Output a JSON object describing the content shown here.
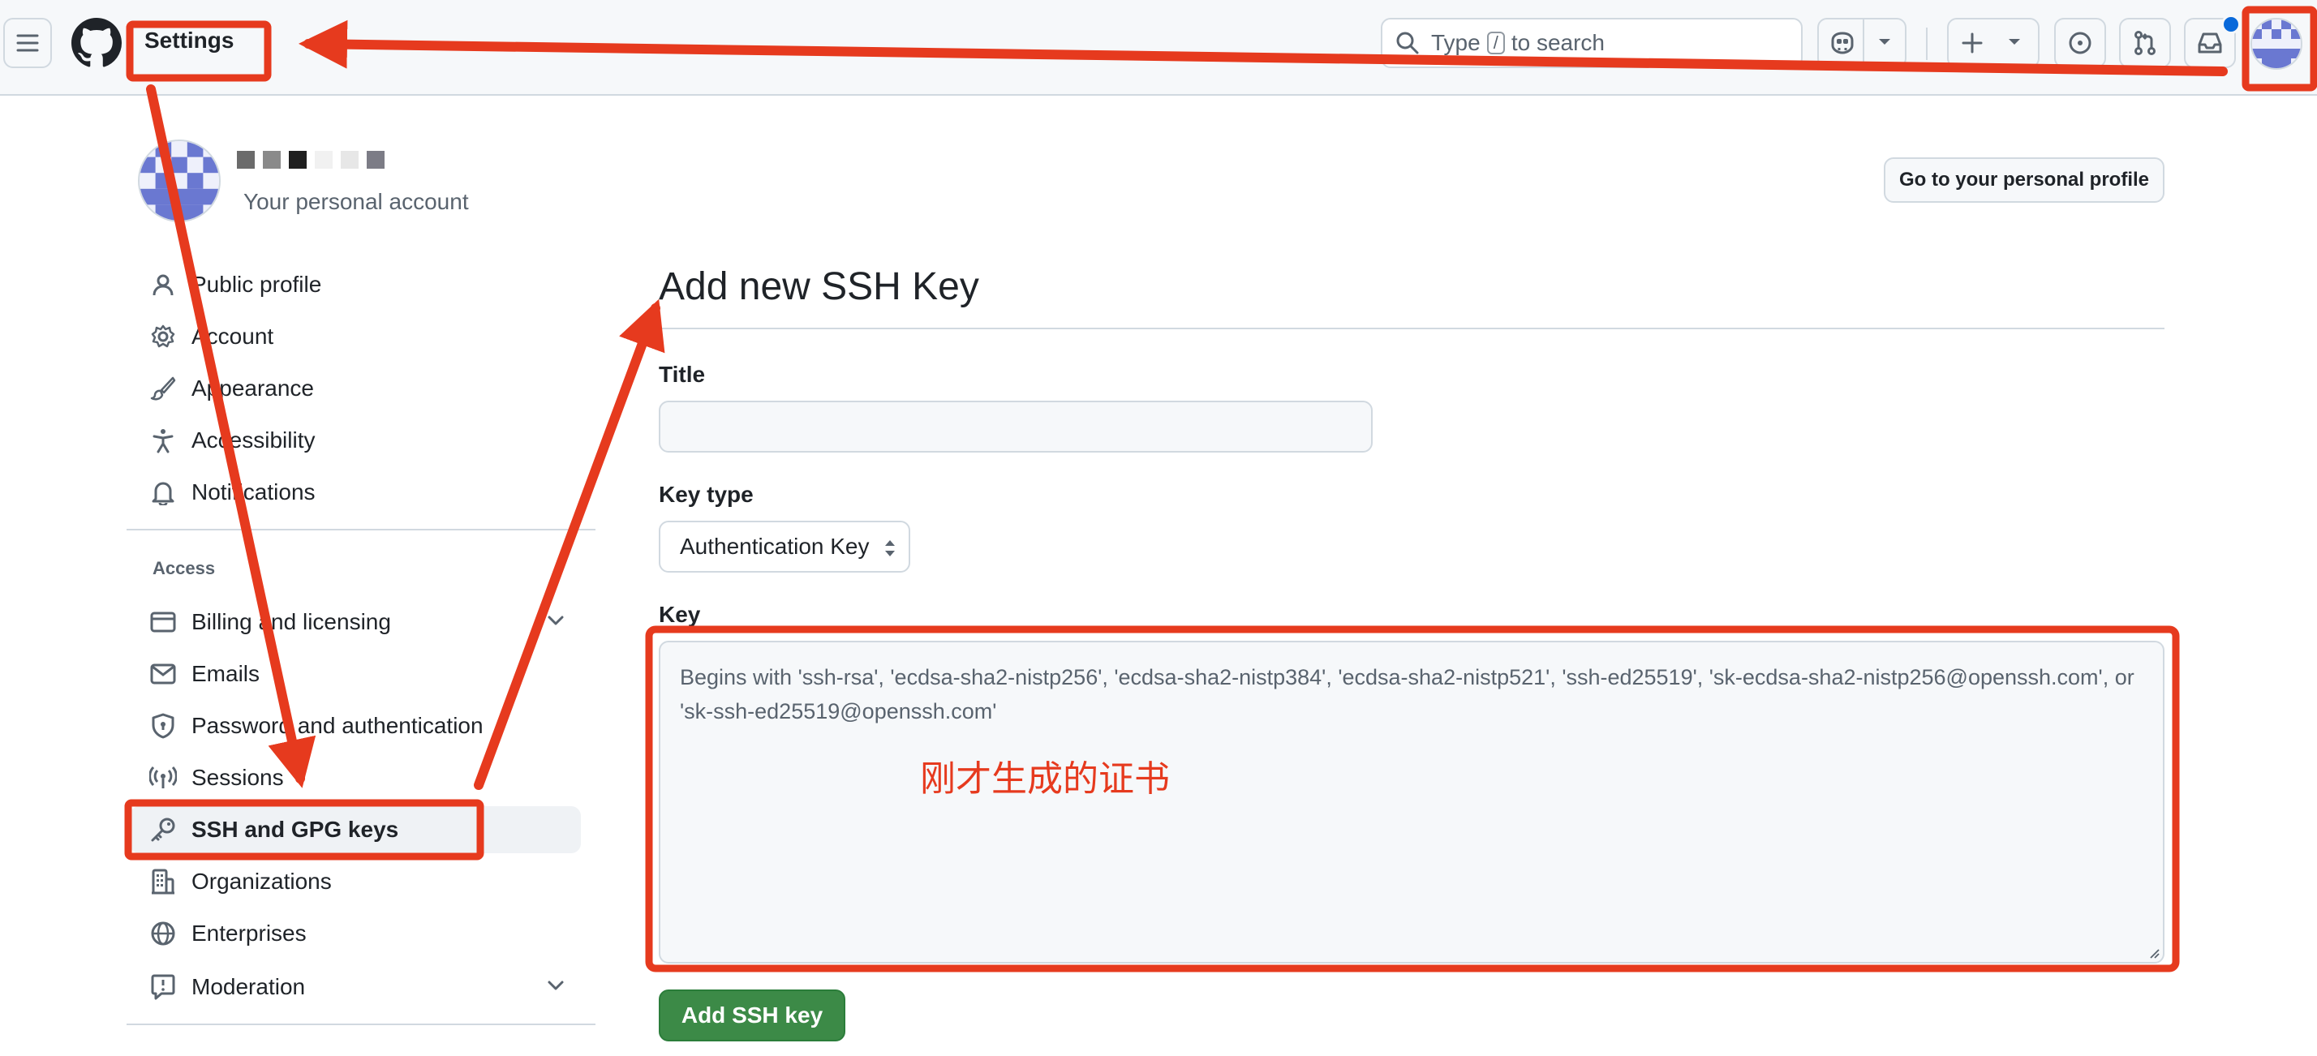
{
  "header": {
    "menu_icon": "hamburger-icon",
    "logo_icon": "github-logo-icon",
    "title": "Settings",
    "search": {
      "text_before": "Type",
      "shortcut_key": "/",
      "text_after": "to search"
    },
    "icons": [
      "copilot-icon",
      "plus-icon",
      "issues-icon",
      "pull-requests-icon",
      "inbox-icon"
    ]
  },
  "account": {
    "subtitle": "Your personal account",
    "profile_button": "Go to your personal profile"
  },
  "sidebar": {
    "items_top": [
      {
        "label": "Public profile",
        "icon": "person-icon"
      },
      {
        "label": "Account",
        "icon": "gear-icon"
      },
      {
        "label": "Appearance",
        "icon": "paintbrush-icon"
      },
      {
        "label": "Accessibility",
        "icon": "accessibility-icon"
      },
      {
        "label": "Notifications",
        "icon": "bell-icon"
      }
    ],
    "access_heading": "Access",
    "items_access": [
      {
        "label": "Billing and licensing",
        "icon": "credit-card-icon",
        "expandable": true
      },
      {
        "label": "Emails",
        "icon": "mail-icon"
      },
      {
        "label": "Password and authentication",
        "icon": "shield-lock-icon"
      },
      {
        "label": "Sessions",
        "icon": "broadcast-icon"
      },
      {
        "label": "SSH and GPG keys",
        "icon": "key-icon",
        "active": true
      },
      {
        "label": "Organizations",
        "icon": "organization-icon"
      },
      {
        "label": "Enterprises",
        "icon": "globe-icon"
      },
      {
        "label": "Moderation",
        "icon": "report-icon",
        "expandable": true
      }
    ]
  },
  "form": {
    "heading": "Add new SSH Key",
    "title_label": "Title",
    "title_value": "",
    "key_type_label": "Key type",
    "key_type_value": "Authentication Key",
    "key_label": "Key",
    "key_placeholder": "Begins with 'ssh-rsa', 'ecdsa-sha2-nistp256', 'ecdsa-sha2-nistp384', 'ecdsa-sha2-nistp521', 'ssh-ed25519', 'sk-ecdsa-sha2-nistp256@openssh.com', or 'sk-ssh-ed25519@openssh.com'",
    "submit_label": "Add SSH key"
  },
  "annotation": {
    "note": "刚才生成的证书",
    "color": "#e63a1e"
  },
  "colors": {
    "accent_blue": "#0969da",
    "submit_green": "#3c8a47",
    "border": "#d1d9e0",
    "annotation_red": "#e63a1e"
  }
}
